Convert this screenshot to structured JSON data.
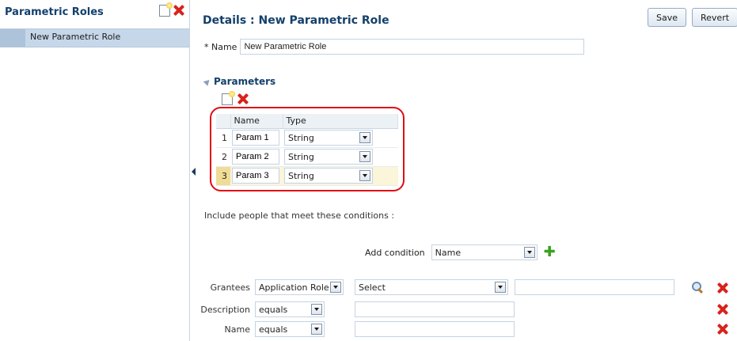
{
  "left_panel": {
    "title": "Parametric Roles",
    "items": [
      {
        "label": "New Parametric Role"
      }
    ]
  },
  "details": {
    "title": "Details : New Parametric Role",
    "save_label": "Save",
    "revert_label": "Revert",
    "name_required_mark": "*",
    "name_label": "Name",
    "name_value": "New Parametric Role"
  },
  "parameters": {
    "section_title": "Parameters",
    "columns": [
      "Name",
      "Type"
    ],
    "rows": [
      {
        "index": "1",
        "name": "Param 1",
        "type": "String"
      },
      {
        "index": "2",
        "name": "Param 2",
        "type": "String"
      },
      {
        "index": "3",
        "name": "Param 3",
        "type": "String"
      }
    ]
  },
  "conditions": {
    "include_text": "Include people that meet these conditions :",
    "add_condition_label": "Add condition",
    "add_condition_value": "Name",
    "rows": [
      {
        "label": "Grantees",
        "operator": "Application Role",
        "value_select": "Select",
        "value_text": ""
      },
      {
        "label": "Description",
        "operator": "equals",
        "value_text": ""
      },
      {
        "label": "Name",
        "operator": "equals",
        "value_text": ""
      }
    ]
  },
  "icons": {
    "new": "new-document-icon",
    "delete": "delete-x-icon",
    "search": "search-icon",
    "add": "plus-icon",
    "collapse": "collapse-triangle-icon"
  },
  "colors": {
    "title": "#13406b",
    "selection": "#c6d7e9",
    "highlight_outline": "#e00d15",
    "delete": "#d8231c",
    "add": "#3aa11f"
  }
}
